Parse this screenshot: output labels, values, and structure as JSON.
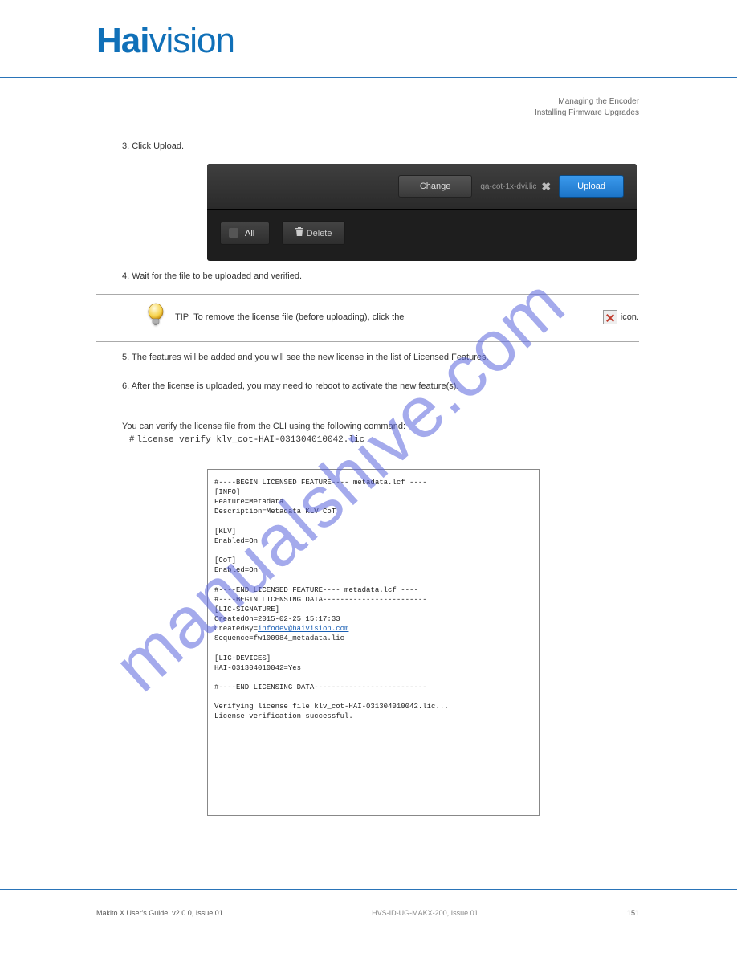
{
  "logo": {
    "bold": "Hai",
    "light": "vision"
  },
  "breadcrumb": {
    "l1": "Managing the Encoder",
    "l2": "Installing Firmware Upgrades"
  },
  "steps": {
    "s3": "3.  Click Upload.",
    "s4": "4.  Wait for the file to be uploaded and verified.",
    "s5": "5.  The features will be added and you will see the new license in the list of Licensed Features.",
    "s6": "6.  After the license is uploaded, you may need to reboot to activate the new feature(s)."
  },
  "panel": {
    "change": "Change",
    "filename": "qa-cot-1x-dvi.lic",
    "upload": "Upload",
    "all": "All",
    "delete": "Delete"
  },
  "tip": {
    "label": "TIP  ",
    "text": "To remove the license file (before uploading), click the ",
    "text2": " icon."
  },
  "cli": {
    "lead": "You can verify the license file from the CLI using the following command:",
    "cmd": "license verify klv_cot-HAI-031304010042.lic"
  },
  "license_text": "#----BEGIN LICENSED FEATURE---- metadata.lcf ----\n[INFO]\nFeature=Metadata\nDescription=Metadata KLV CoT\n\n[KLV]\nEnabled=On\n\n[CoT]\nEnabled=On\n\n#----END LICENSED FEATURE---- metadata.lcf ----\n#----BEGIN LICENSING DATA------------------------\n[LIC-SIGNATURE]\nCreatedOn=2015-02-25 15:17:33\nCreatedBy=",
  "license_email": "infodev@haivision.com",
  "license_text2": "\nSequence=fw100984_metadata.lic\n\n[LIC-DEVICES]\nHAI-031304010042=Yes\n\n#----END LICENSING DATA--------------------------\n\nVerifying license file klv_cot-HAI-031304010042.lic...\nLicense verification successful.",
  "footer": {
    "left": "Makito X User's Guide, v2.0.0, Issue 01",
    "mid": "HVS-ID-UG-MAKX-200, Issue 01",
    "right": "151"
  },
  "watermark": "manualshive.com"
}
